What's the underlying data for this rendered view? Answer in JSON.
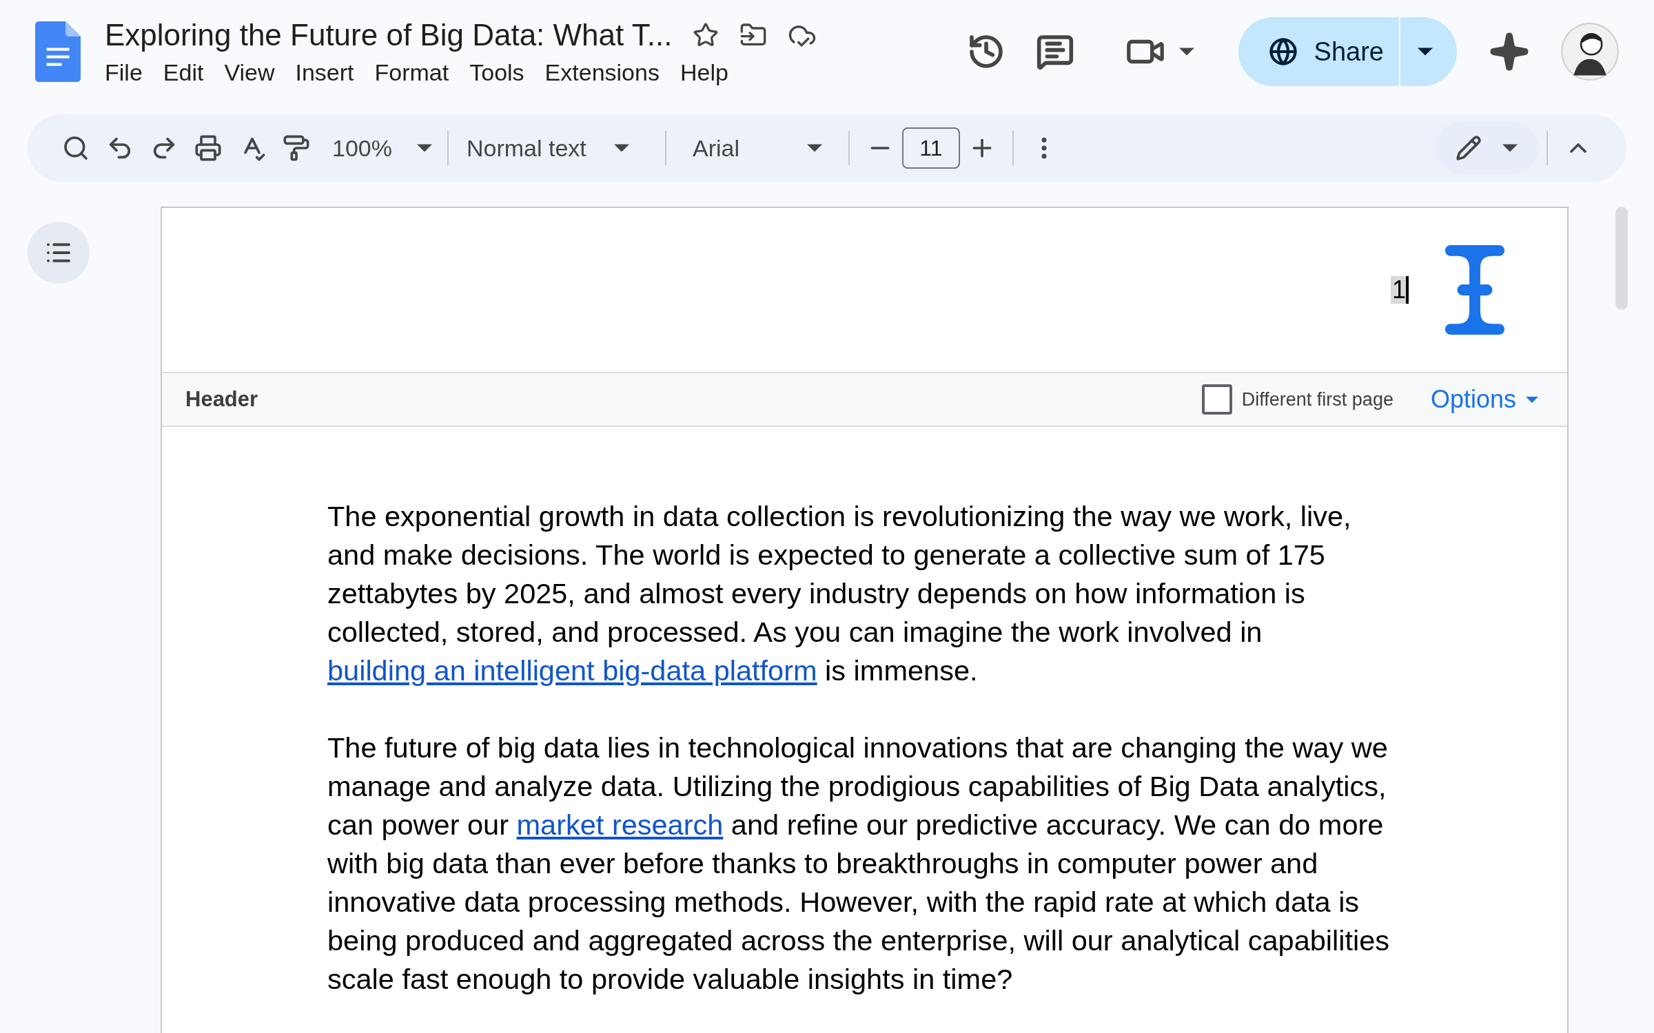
{
  "document": {
    "title": "Exploring the Future of Big Data: What T..."
  },
  "menu": [
    "File",
    "Edit",
    "View",
    "Insert",
    "Format",
    "Tools",
    "Extensions",
    "Help"
  ],
  "share_button": {
    "label": "Share"
  },
  "toolbar": {
    "zoom": "100%",
    "style": "Normal text",
    "font": "Arial",
    "font_size": "11"
  },
  "header": {
    "text": "1",
    "label": "Header",
    "different_first_page": {
      "label": "Different first page",
      "checked": false
    },
    "options": "Options"
  },
  "paragraphs": [
    {
      "segments": [
        {
          "kind": "text",
          "text": "The exponential growth in data collection is revolutionizing the way we work, live, and make decisions. The world is expected to generate a collective sum of 175 zettabytes by 2025, and almost every industry depends on how information is collected, stored, and processed. As you can imagine the work involved in "
        },
        {
          "kind": "link",
          "text": "building an intelligent big-data platform"
        },
        {
          "kind": "text",
          "text": " is immense."
        }
      ]
    },
    {
      "segments": [
        {
          "kind": "text",
          "text": "The future of big data lies in technological innovations that are changing the way we manage and analyze data. Utilizing the prodigious capabilities of Big Data analytics, can power our "
        },
        {
          "kind": "link",
          "text": "market research"
        },
        {
          "kind": "text",
          "text": " and refine our predictive accuracy. We can do more with big data than ever before thanks to breakthroughs in computer power and innovative data processing methods. However, with the rapid rate at which data is being produced and aggregated across the enterprise, will our analytical capabilities scale fast enough to provide valuable insights in time?"
        }
      ]
    }
  ]
}
